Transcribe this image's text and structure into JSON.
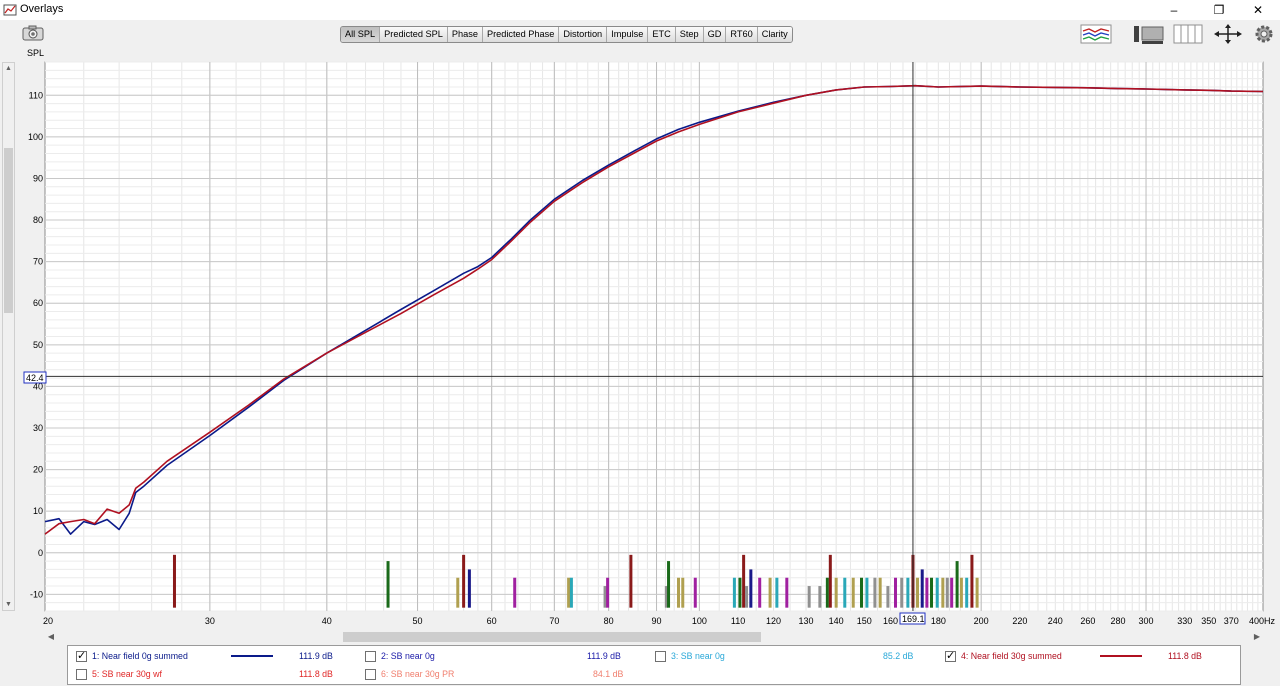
{
  "window": {
    "title": "Overlays",
    "minimize": "–",
    "restore": "❐",
    "close": "✕"
  },
  "toolbar": {
    "axis_label": "SPL",
    "tabs": [
      "All SPL",
      "Predicted SPL",
      "Phase",
      "Predicted Phase",
      "Distortion",
      "Impulse",
      "ETC",
      "Step",
      "GD",
      "RT60",
      "Clarity"
    ],
    "active_tab": "All SPL",
    "icons": [
      "camera-icon",
      "traces-icon",
      "controls-icon",
      "layout-icon",
      "move-icon",
      "gear-icon"
    ]
  },
  "cursor": {
    "freq_label": "169.1",
    "spl_label": "42.4"
  },
  "chart_data": {
    "type": "line",
    "x_scale": "log",
    "xlim": [
      20,
      400
    ],
    "ylim": [
      -14,
      118
    ],
    "x_ticks": [
      "20",
      "30",
      "40",
      "50",
      "60",
      "70",
      "80",
      "90",
      "100",
      "110",
      "120",
      "130",
      "140",
      "150",
      "160",
      "180",
      "200",
      "220",
      "240",
      "260",
      "280",
      "300",
      "330",
      "350",
      "370",
      "400Hz"
    ],
    "y_ticks": [
      "110",
      "100",
      "90",
      "80",
      "70",
      "60",
      "50",
      "40",
      "30",
      "20",
      "10",
      "0",
      "-10"
    ],
    "ylabel": "SPL",
    "grid": true,
    "series": [
      {
        "name": "1: Near field 0g summed",
        "color": "#0a1a8a",
        "x": [
          20,
          20.7,
          21.3,
          22,
          22.6,
          23.3,
          24,
          24.6,
          25,
          25.5,
          27,
          30,
          33,
          36,
          40,
          44,
          48,
          52,
          56,
          58,
          60,
          63,
          66,
          70,
          75,
          80,
          85,
          90,
          95,
          100,
          110,
          120,
          130,
          140,
          150,
          160,
          170,
          180,
          200,
          220,
          240,
          260,
          280,
          300,
          330,
          350,
          370,
          400
        ],
        "y": [
          7.5,
          8.2,
          4.5,
          7.5,
          6.8,
          8,
          5.6,
          9.5,
          14.5,
          16,
          21,
          28.2,
          35,
          41.5,
          48,
          53.5,
          58.5,
          63,
          67.2,
          68.8,
          71,
          75.5,
          80,
          85,
          89.5,
          93.2,
          96.5,
          99.5,
          101.8,
          103.5,
          106.2,
          108.3,
          110,
          111.3,
          112,
          112.1,
          112.3,
          112,
          112.2,
          112,
          111.9,
          111.8,
          111.6,
          111.5,
          111.3,
          111.2,
          111,
          110.9
        ]
      },
      {
        "name": "4: Near field 30g summed",
        "color": "#b01020",
        "x": [
          20,
          20.7,
          21.3,
          22,
          22.6,
          23.3,
          24,
          24.6,
          25,
          25.5,
          27,
          30,
          33,
          36,
          40,
          44,
          48,
          52,
          56,
          58,
          60,
          63,
          66,
          70,
          75,
          80,
          85,
          90,
          95,
          100,
          110,
          120,
          130,
          140,
          150,
          160,
          170,
          180,
          200,
          220,
          240,
          260,
          280,
          300,
          330,
          350,
          370,
          400
        ],
        "y": [
          4.5,
          7,
          7.5,
          8,
          7,
          10.5,
          9.5,
          11.5,
          15.5,
          17,
          22,
          29,
          35.5,
          41.8,
          48,
          53,
          57.5,
          62,
          66,
          68.2,
          70.5,
          75,
          79.5,
          84.5,
          89,
          92.8,
          96,
          99,
          101.2,
          103,
          106,
          108.1,
          110,
          111.3,
          112,
          112.1,
          112.3,
          112,
          112.2,
          112,
          111.9,
          111.8,
          111.6,
          111.5,
          111.3,
          111.2,
          111,
          110.9
        ]
      }
    ]
  },
  "legend": [
    {
      "label": "1: Near field 0g summed",
      "value": "111.9 dB",
      "checked": true,
      "color": "#0a1a8a"
    },
    {
      "label": "2: SB near 0g",
      "value": "111.9 dB",
      "checked": false,
      "color": "#1a1aa8"
    },
    {
      "label": "3: SB near 0g",
      "value": "85.2 dB",
      "checked": false,
      "color": "#2aa8d8"
    },
    {
      "label": "4: Near field 30g summed",
      "value": "111.8 dB",
      "checked": true,
      "color": "#b01020"
    },
    {
      "label": "5: SB near 30g wf",
      "value": "111.8 dB",
      "checked": false,
      "color": "#e02828"
    },
    {
      "label": "6: SB near 30g PR",
      "value": "84.1 dB",
      "checked": false,
      "color": "#f08070"
    }
  ]
}
